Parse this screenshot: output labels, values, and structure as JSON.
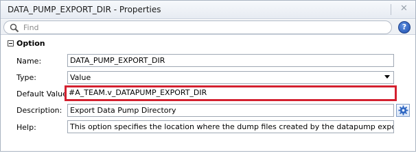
{
  "window": {
    "title": "DATA_PUMP_EXPORT_DIR - Properties"
  },
  "search": {
    "placeholder": "Find",
    "help_label": "?"
  },
  "section": {
    "title": "Option"
  },
  "fields": {
    "name": {
      "label": "Name:",
      "value": "DATA_PUMP_EXPORT_DIR"
    },
    "type": {
      "label": "Type:",
      "value": "Value"
    },
    "default_value": {
      "label": "Default Value:",
      "value": "#A_TEAM.v_DATAPUMP_EXPORT_DIR"
    },
    "description": {
      "label": "Description:",
      "value": "Export Data Pump Directory"
    },
    "help": {
      "label": "Help:",
      "value": "This option specifies the location where the dump files created by the datapump export operation a"
    }
  },
  "icons": {
    "search": "search-icon",
    "help": "help-icon",
    "gear": "gear-icon",
    "collapse": "collapse-icon",
    "close": "close-icon",
    "dropdown": "chevron-down-icon"
  },
  "colors": {
    "highlight": "#d3202f",
    "help_button": "#1f4fae"
  }
}
